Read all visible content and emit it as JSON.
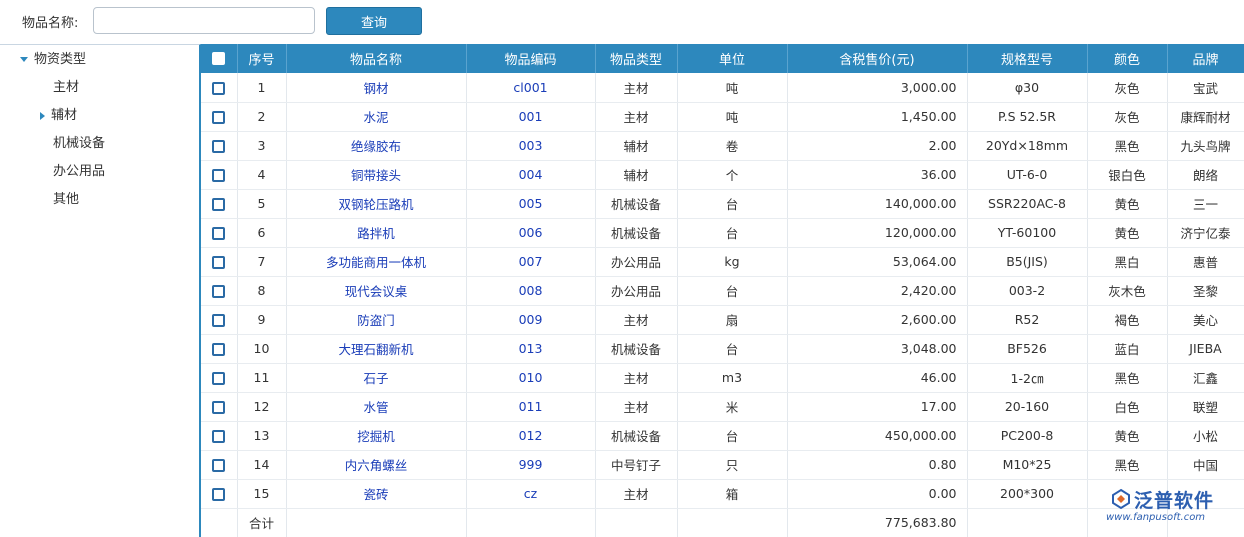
{
  "search": {
    "label": "物品名称:",
    "value": "",
    "placeholder": "",
    "button_label": "查询"
  },
  "tree": {
    "root": "物资类型",
    "children": [
      "主材",
      "辅材",
      "机械设备",
      "办公用品",
      "其他"
    ]
  },
  "table": {
    "headers": [
      "序号",
      "物品名称",
      "物品编码",
      "物品类型",
      "单位",
      "含税售价(元)",
      "规格型号",
      "颜色",
      "品牌"
    ],
    "rows": [
      {
        "no": "1",
        "name": "钢材",
        "code": "cl001",
        "type": "主材",
        "unit": "吨",
        "price": "3,000.00",
        "spec": "φ30",
        "color": "灰色",
        "brand": "宝武"
      },
      {
        "no": "2",
        "name": "水泥",
        "code": "001",
        "type": "主材",
        "unit": "吨",
        "price": "1,450.00",
        "spec": "P.S 52.5R",
        "color": "灰色",
        "brand": "康辉耐材"
      },
      {
        "no": "3",
        "name": "绝缘胶布",
        "code": "003",
        "type": "辅材",
        "unit": "卷",
        "price": "2.00",
        "spec": "20Yd×18mm",
        "color": "黑色",
        "brand": "九头鸟牌"
      },
      {
        "no": "4",
        "name": "铜带接头",
        "code": "004",
        "type": "辅材",
        "unit": "个",
        "price": "36.00",
        "spec": "UT-6-0",
        "color": "银白色",
        "brand": "朗络"
      },
      {
        "no": "5",
        "name": "双钢轮压路机",
        "code": "005",
        "type": "机械设备",
        "unit": "台",
        "price": "140,000.00",
        "spec": "SSR220AC-8",
        "color": "黄色",
        "brand": "三一"
      },
      {
        "no": "6",
        "name": "路拌机",
        "code": "006",
        "type": "机械设备",
        "unit": "台",
        "price": "120,000.00",
        "spec": "YT-60100",
        "color": "黄色",
        "brand": "济宁亿泰"
      },
      {
        "no": "7",
        "name": "多功能商用一体机",
        "code": "007",
        "type": "办公用品",
        "unit": "kg",
        "price": "53,064.00",
        "spec": "B5(JIS)",
        "color": "黑白",
        "brand": "惠普"
      },
      {
        "no": "8",
        "name": "现代会议桌",
        "code": "008",
        "type": "办公用品",
        "unit": "台",
        "price": "2,420.00",
        "spec": "003-2",
        "color": "灰木色",
        "brand": "圣黎"
      },
      {
        "no": "9",
        "name": "防盗门",
        "code": "009",
        "type": "主材",
        "unit": "扇",
        "price": "2,600.00",
        "spec": "R52",
        "color": "褐色",
        "brand": "美心"
      },
      {
        "no": "10",
        "name": "大理石翻新机",
        "code": "013",
        "type": "机械设备",
        "unit": "台",
        "price": "3,048.00",
        "spec": "BF526",
        "color": "蓝白",
        "brand": "JIEBA"
      },
      {
        "no": "11",
        "name": "石子",
        "code": "010",
        "type": "主材",
        "unit": "m3",
        "price": "46.00",
        "spec": "1-2㎝",
        "color": "黑色",
        "brand": "汇鑫"
      },
      {
        "no": "12",
        "name": "水管",
        "code": "011",
        "type": "主材",
        "unit": "米",
        "price": "17.00",
        "spec": "20-160",
        "color": "白色",
        "brand": "联塑"
      },
      {
        "no": "13",
        "name": "挖掘机",
        "code": "012",
        "type": "机械设备",
        "unit": "台",
        "price": "450,000.00",
        "spec": "PC200-8",
        "color": "黄色",
        "brand": "小松"
      },
      {
        "no": "14",
        "name": "内六角螺丝",
        "code": "999",
        "type": "中号钉子",
        "unit": "只",
        "price": "0.80",
        "spec": "M10*25",
        "color": "黑色",
        "brand": "中国"
      },
      {
        "no": "15",
        "name": "瓷砖",
        "code": "cz",
        "type": "主材",
        "unit": "箱",
        "price": "0.00",
        "spec": "200*300",
        "color": "",
        "brand": ""
      }
    ],
    "total_label": "合计",
    "total_price": "775,683.80"
  },
  "watermark": {
    "text": "泛普软件",
    "url": "www.fanpusoft.com"
  },
  "colors": {
    "header_bg": "#2d88bd",
    "link_text": "#1a3db8"
  }
}
